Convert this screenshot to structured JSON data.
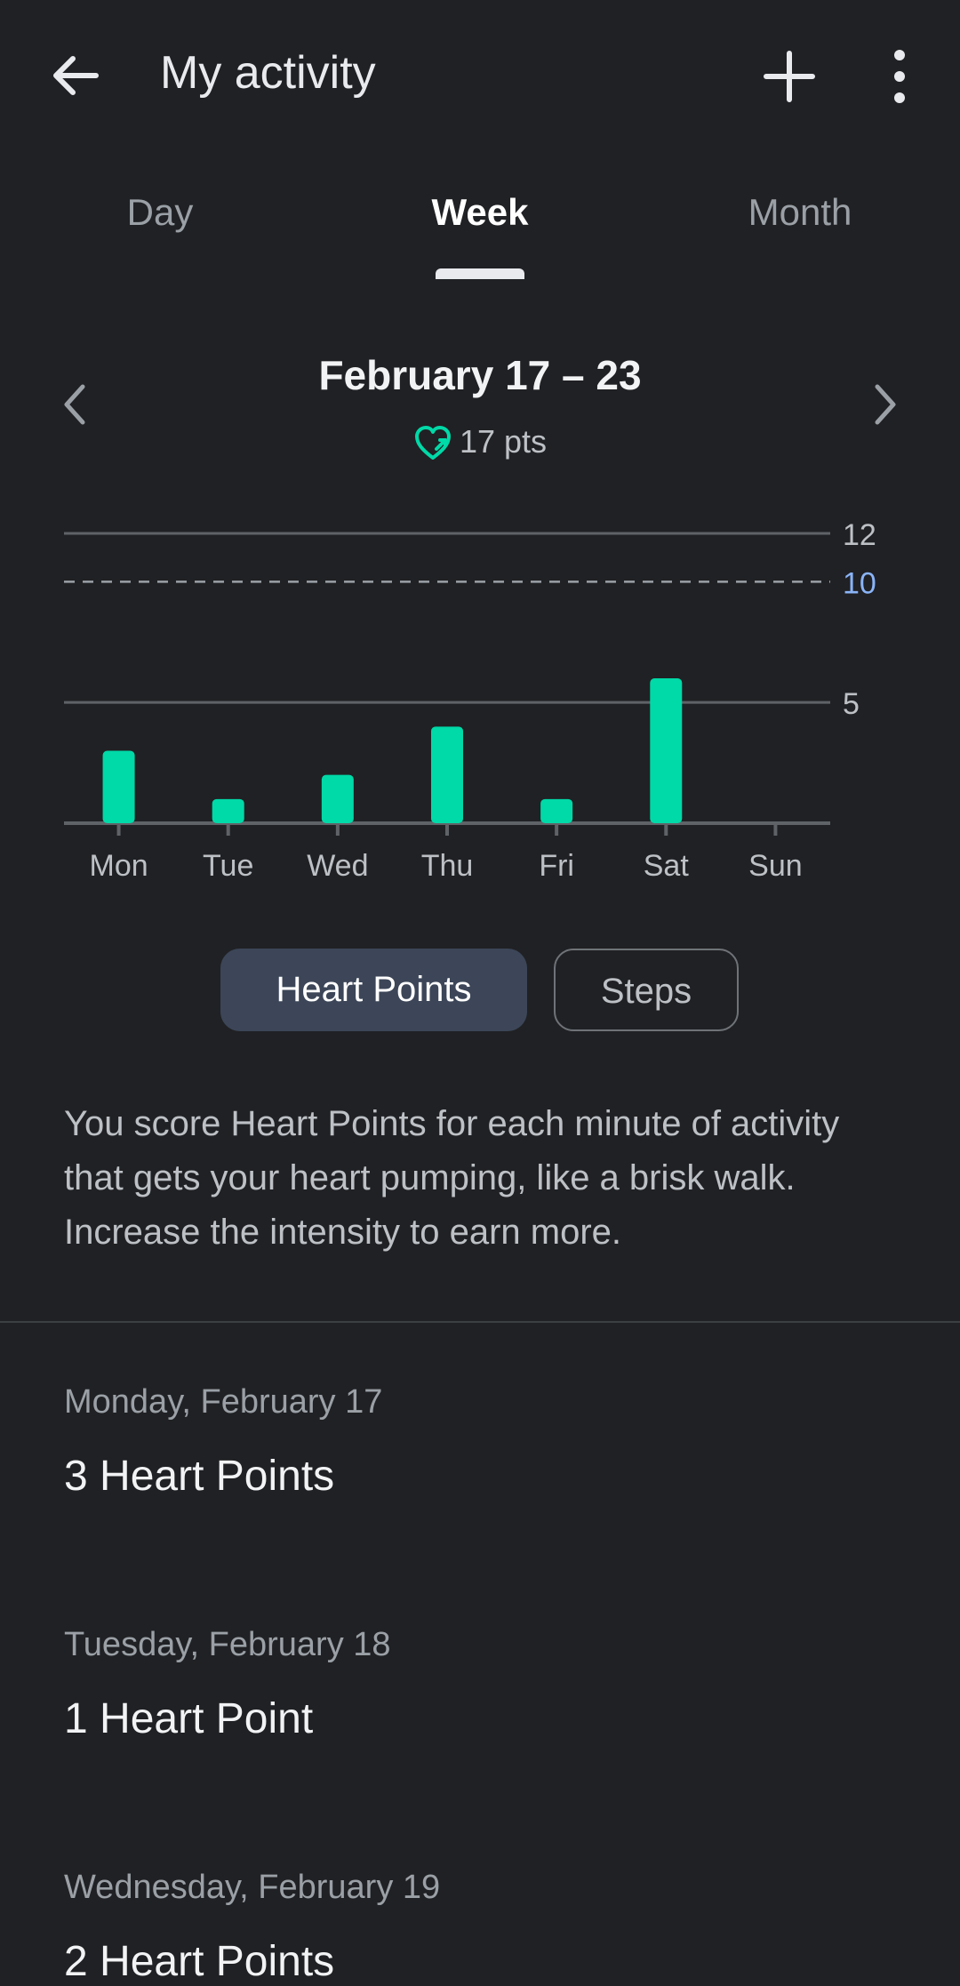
{
  "app_bar": {
    "title": "My activity"
  },
  "tabs": [
    "Day",
    "Week",
    "Month"
  ],
  "range": {
    "title": "February 17 – 23",
    "points": "17 pts"
  },
  "chart_data": {
    "type": "bar",
    "categories": [
      "Mon",
      "Tue",
      "Wed",
      "Thu",
      "Fri",
      "Sat",
      "Sun"
    ],
    "values": [
      3,
      1,
      2,
      4,
      1,
      6,
      0
    ],
    "ylim": [
      0,
      12
    ],
    "gridlines": [
      5,
      12
    ],
    "goal": 10,
    "y_ticks": [
      "5",
      "10",
      "12"
    ],
    "bar_color": "#00d9a8",
    "goal_color": "#8ab4f8"
  },
  "toggles": {
    "heart_points": "Heart Points",
    "steps": "Steps"
  },
  "description": "You score Heart Points for each minute of activity that gets your heart pumping, like a brisk walk. Increase the intensity to earn more.",
  "days": [
    {
      "date": "Monday, February 17",
      "value": "3 Heart Points"
    },
    {
      "date": "Tuesday, February 18",
      "value": "1 Heart Point"
    },
    {
      "date": "Wednesday, February 19",
      "value": "2 Heart Points"
    }
  ]
}
